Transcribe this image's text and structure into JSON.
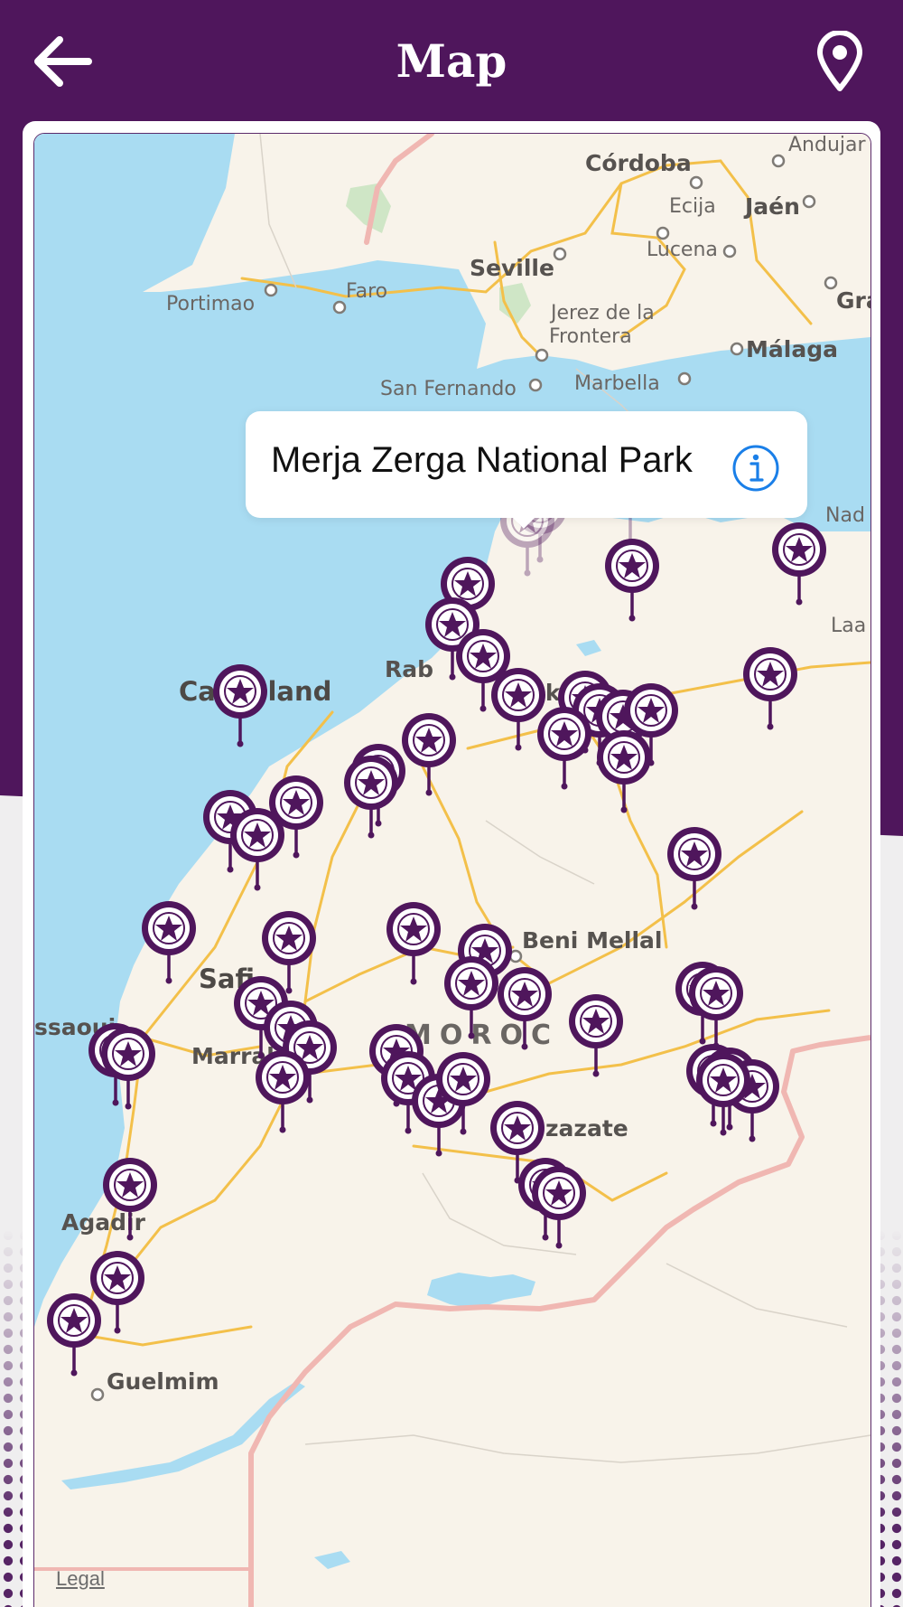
{
  "header": {
    "title": "Map",
    "back_icon": "arrow-left-icon",
    "location_icon": "location-pin-icon"
  },
  "colors": {
    "brand": "#4f165c",
    "water": "#a9dcf2",
    "land": "#f8f3ea",
    "road": "#f3c04a",
    "border": "#f0b7b2"
  },
  "map": {
    "labels": [
      {
        "text": "Córdoba"
      },
      {
        "text": "Andujar"
      },
      {
        "text": "Ecija"
      },
      {
        "text": "Jaén"
      },
      {
        "text": "Seville"
      },
      {
        "text": "Lucena"
      },
      {
        "text": "Gra"
      },
      {
        "text": "Portimao"
      },
      {
        "text": "Faro"
      },
      {
        "text": "Jerez de la"
      },
      {
        "text": "Frontera"
      },
      {
        "text": "Málaga"
      },
      {
        "text": "San Fernando"
      },
      {
        "text": "Marbella"
      },
      {
        "text": "Nad"
      },
      {
        "text": "Laa"
      },
      {
        "text": "Rab"
      },
      {
        "text": "Casabland"
      },
      {
        "text": "Meknès"
      },
      {
        "text": "Beni Mellal"
      },
      {
        "text": "Safi"
      },
      {
        "text": "ssaoui"
      },
      {
        "text": "Marrakec"
      },
      {
        "text": "MOROC"
      },
      {
        "text": "zazate"
      },
      {
        "text": "Agadir"
      },
      {
        "text": "Guelmim"
      }
    ],
    "marker_icon": "star-pin-icon",
    "legal": "Legal"
  },
  "callout": {
    "title": "Merja Zerga National Park",
    "info_icon": "info-icon"
  }
}
